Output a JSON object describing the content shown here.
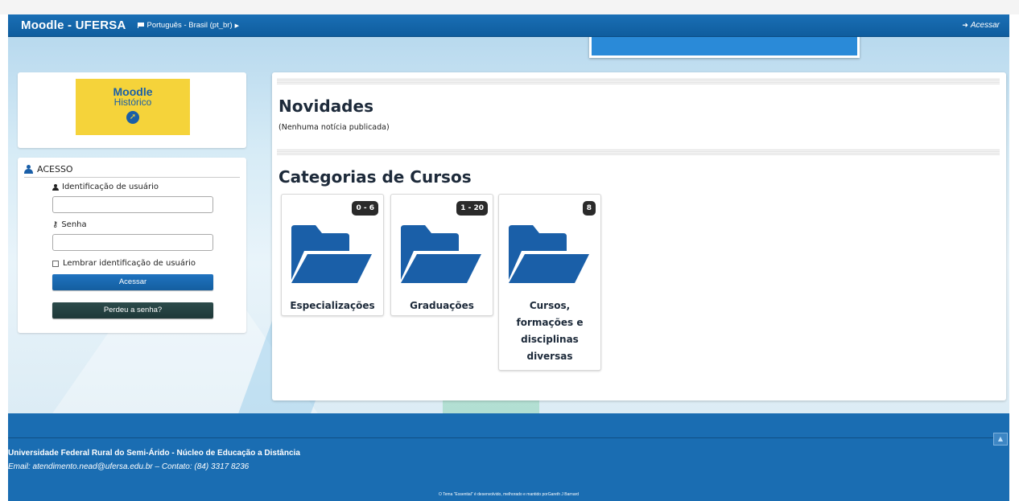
{
  "navbar": {
    "brand": "Moodle - UFERSA",
    "language": "Português - Brasil (pt_br)",
    "login_link": "Acessar"
  },
  "logo": {
    "title": "Moodle",
    "subtitle": "Histórico"
  },
  "login": {
    "heading": "ACESSO",
    "username_label": "Identificação de usuário",
    "username_value": "",
    "password_label": "Senha",
    "password_value": "",
    "remember_label": "Lembrar identificação de usuário",
    "remember_checked": false,
    "submit_label": "Acessar",
    "forgot_label": "Perdeu a senha?"
  },
  "main": {
    "news_title": "Novidades",
    "news_empty": "(Nenhuma notícia publicada)",
    "categories_title": "Categorias de Cursos",
    "categories": [
      {
        "badge": "0 - 6",
        "name": "Especializações"
      },
      {
        "badge": "1 - 20",
        "name": "Graduações"
      },
      {
        "badge": "8",
        "name_lines": [
          "Cursos,",
          "formações e",
          "disciplinas",
          "diversas"
        ]
      }
    ]
  },
  "footer": {
    "title": "Universidade Federal Rural do Semi-Árido - Núcleo de Educação a Distância",
    "contact": "Email: atendimento.nead@ufersa.edu.br – Contato: (84) 3317 8236",
    "credit": "O Tema \"Essential\" é desenvolvido, melhorado e mantido porGareth J Barnard"
  },
  "colors": {
    "primary": "#1a6db2",
    "dark_button": "#2c4b4b",
    "logo_yellow": "#f5d33a",
    "badge": "#2a2a2a"
  }
}
